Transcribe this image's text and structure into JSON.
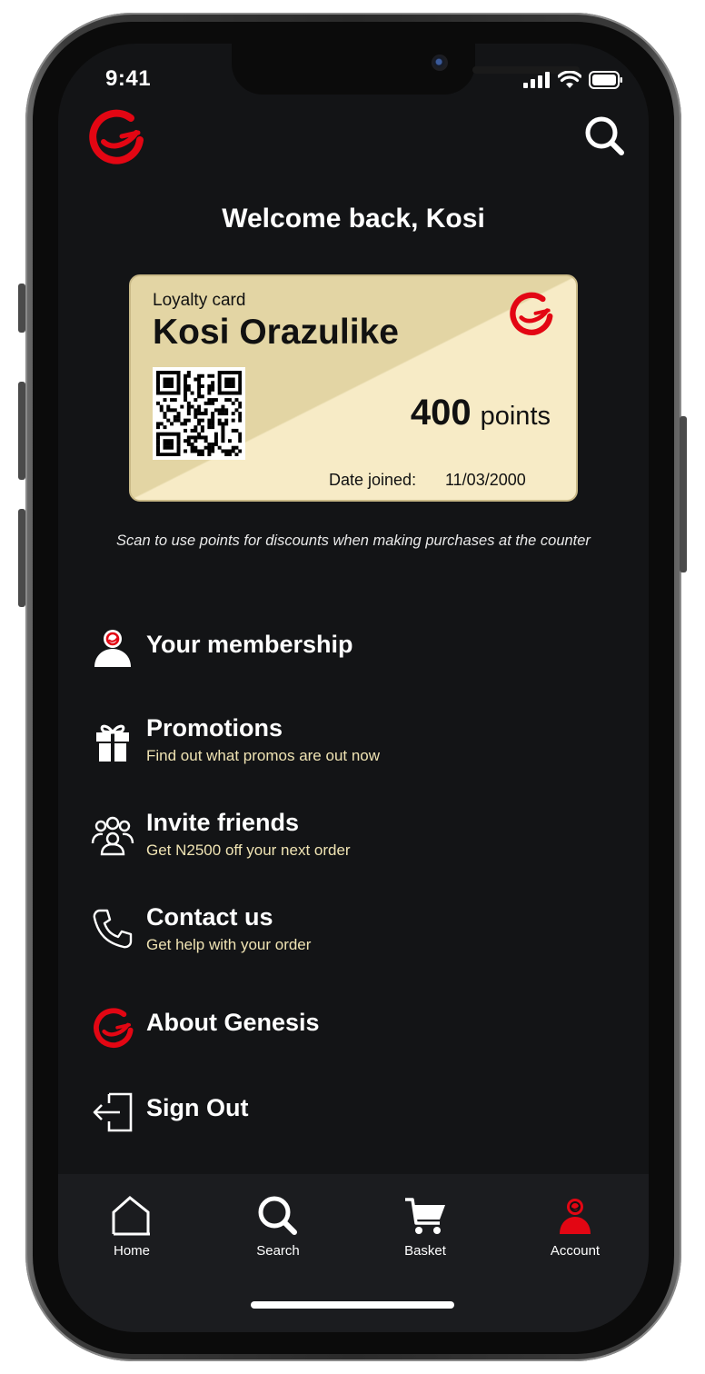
{
  "status_bar": {
    "time": "9:41"
  },
  "header": {
    "logo_icon": "genesis-logo-icon",
    "search_icon": "search-icon"
  },
  "welcome": "Welcome back, Kosi",
  "card": {
    "kicker": "Loyalty card",
    "name": "Kosi Orazulike",
    "points_value": "400",
    "points_unit": "points",
    "date_label": "Date joined:",
    "date_value": "11/03/2000",
    "background_color": "#e3d5a4",
    "accent_color": "#f7ebc6"
  },
  "scan_note": "Scan to use points for discounts when making purchases at the counter",
  "menu": [
    {
      "icon": "member-icon",
      "title": "Your membership"
    },
    {
      "icon": "gift-icon",
      "title": "Promotions",
      "subtitle": "Find out what promos are out now"
    },
    {
      "icon": "friends-icon",
      "title": "Invite friends",
      "subtitle": "Get N2500 off your next order"
    },
    {
      "icon": "phone-icon",
      "title": "Contact us",
      "subtitle": "Get help with your order"
    },
    {
      "icon": "genesis-logo-icon",
      "title": "About Genesis"
    },
    {
      "icon": "sign-out-icon",
      "title": "Sign Out"
    }
  ],
  "tabbar": [
    {
      "icon": "home-icon",
      "label": "Home"
    },
    {
      "icon": "search-icon",
      "label": "Search"
    },
    {
      "icon": "cart-icon",
      "label": "Basket"
    },
    {
      "icon": "account-icon",
      "label": "Account",
      "active": true
    }
  ],
  "colors": {
    "brand_red": "#e30613",
    "background": "#131416",
    "subtitle_gold": "#efe3b3"
  }
}
